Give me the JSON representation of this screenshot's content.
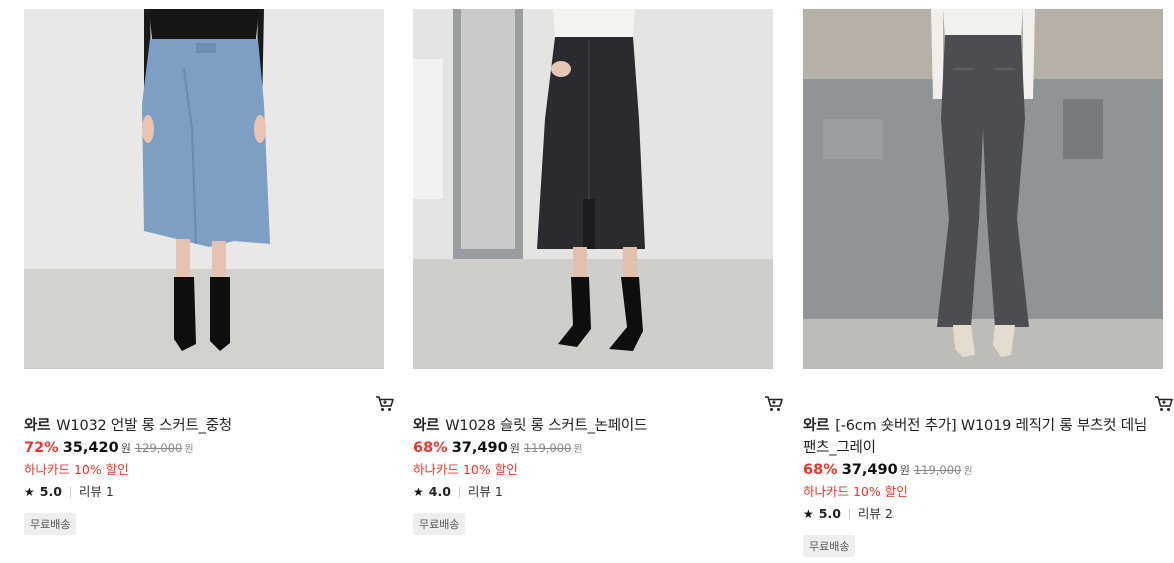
{
  "products": [
    {
      "brand": "와르",
      "name": "W1032 언발 롱 스커트_중청",
      "discount": "72%",
      "price": "35,420",
      "currency": "원",
      "original_price": "129,000",
      "card_promo": "하나카드 10% 할인",
      "rating": "5.0",
      "reviews": "리뷰 1",
      "badge": "무료배송",
      "cart_icon": "cart-icon"
    },
    {
      "brand": "와르",
      "name": "W1028 슬릿 롱 스커트_논페이드",
      "discount": "68%",
      "price": "37,490",
      "currency": "원",
      "original_price": "119,000",
      "card_promo": "하나카드 10% 할인",
      "rating": "4.0",
      "reviews": "리뷰 1",
      "badge": "무료배송",
      "cart_icon": "cart-icon"
    },
    {
      "brand": "와르",
      "name": "[-6cm 숏버전 추가] W1019 레직기 롱 부츠컷 데님 팬츠_그레이",
      "discount": "68%",
      "price": "37,490",
      "currency": "원",
      "original_price": "119,000",
      "card_promo": "하나카드 10% 할인",
      "rating": "5.0",
      "reviews": "리뷰 2",
      "badge": "무료배송",
      "cart_icon": "cart-icon"
    }
  ],
  "colors": {
    "discount": "#e8382f",
    "badge_bg": "#eeeeee"
  }
}
